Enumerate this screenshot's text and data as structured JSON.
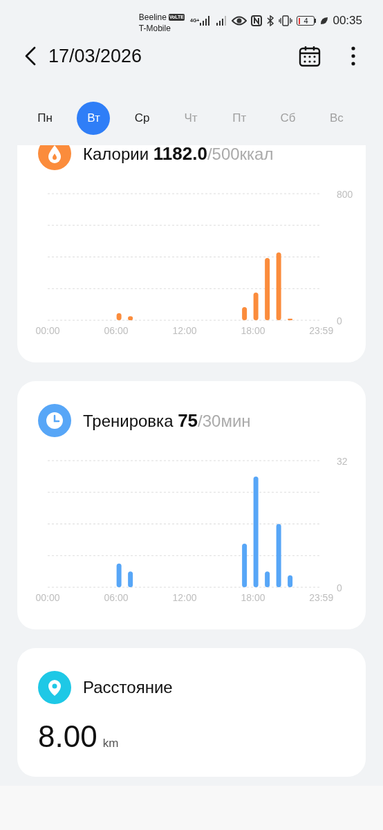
{
  "status_bar": {
    "carrier_1": "Beeline",
    "volte_badge": "VoLTE",
    "network_type": "4G+",
    "carrier_2": "T-Mobile",
    "battery_text": "4",
    "time": "00:35"
  },
  "header": {
    "date": "17/03/2026"
  },
  "week_days": [
    {
      "label": "Пн",
      "selected": false,
      "disabled": false
    },
    {
      "label": "Вт",
      "selected": true,
      "disabled": false
    },
    {
      "label": "Ср",
      "selected": false,
      "disabled": false
    },
    {
      "label": "Чт",
      "selected": false,
      "disabled": true
    },
    {
      "label": "Пт",
      "selected": false,
      "disabled": true
    },
    {
      "label": "Сб",
      "selected": false,
      "disabled": true
    },
    {
      "label": "Вс",
      "selected": false,
      "disabled": true
    }
  ],
  "cards": [
    {
      "kind": "calories",
      "title": "Калории",
      "value": "1182.0",
      "goal": "/500ккал",
      "chart_data": {
        "type": "bar",
        "x": [
          6.25,
          7.25,
          17.25,
          18.25,
          19.25,
          20.25,
          21.25
        ],
        "series": [
          {
            "color": "#fb8c3c",
            "values": [
              45,
              25,
              83,
              175,
              393,
              428,
              10
            ]
          }
        ],
        "xlim": [
          0,
          24
        ],
        "ylim": [
          0,
          800
        ],
        "xticks": [
          {
            "value": 0,
            "label": "00:00"
          },
          {
            "value": 6,
            "label": "06:00"
          },
          {
            "value": 12,
            "label": "12:00"
          },
          {
            "value": 18,
            "label": "18:00"
          },
          {
            "value": 23.98,
            "label": "23:59"
          }
        ],
        "yticks": [
          0,
          800
        ]
      }
    },
    {
      "kind": "workout",
      "title": "Тренировка",
      "value": "75",
      "goal": "/30мин",
      "chart_data": {
        "type": "bar",
        "x": [
          6.25,
          7.25,
          17.25,
          18.25,
          19.25,
          20.25,
          21.25
        ],
        "series": [
          {
            "color": "#57a6f7",
            "values": [
              6,
              4,
              11,
              28,
              4,
              16,
              3
            ]
          }
        ],
        "xlim": [
          0,
          24
        ],
        "ylim": [
          0,
          32
        ],
        "xticks": [
          {
            "value": 0,
            "label": "00:00"
          },
          {
            "value": 6,
            "label": "06:00"
          },
          {
            "value": 12,
            "label": "12:00"
          },
          {
            "value": 18,
            "label": "18:00"
          },
          {
            "value": 23.98,
            "label": "23:59"
          }
        ],
        "yticks": [
          0,
          32
        ]
      }
    },
    {
      "kind": "distance",
      "title": "Расстояние",
      "value": "8.00",
      "unit": "km"
    }
  ]
}
